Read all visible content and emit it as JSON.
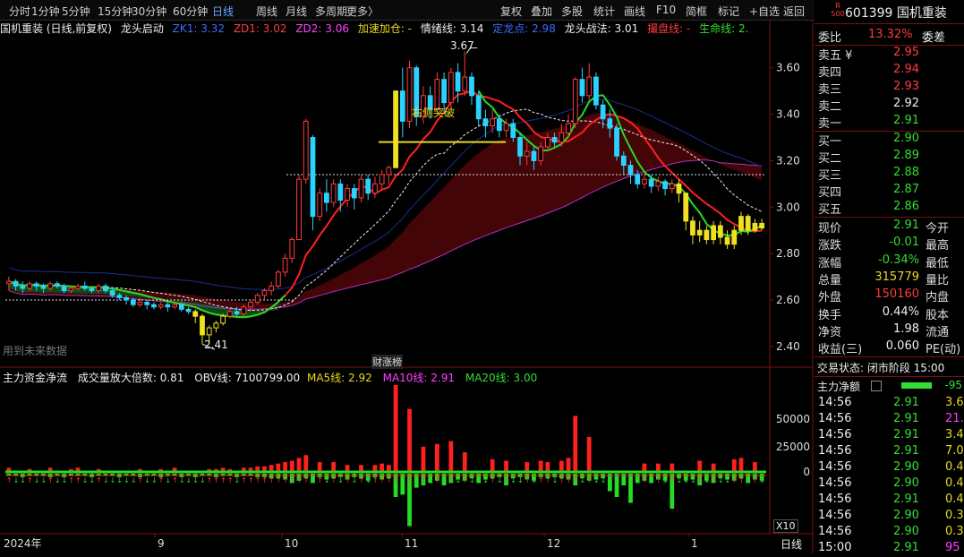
{
  "toolbar": {
    "left_tabs": [
      "分时",
      "1分钟",
      "5分钟",
      "15分钟",
      "30分钟",
      "60分钟",
      "日线",
      "周线",
      "月线",
      "多周期",
      "更多〉"
    ],
    "active_tab": "日线",
    "right_buttons": [
      "复权",
      "叠加",
      "多股",
      "统计",
      "画线",
      "F10",
      "简框",
      "标记",
      "+自选",
      "返回"
    ]
  },
  "stock": {
    "code": "601399",
    "name": "国机重装",
    "badge_top": "R",
    "badge_bottom": "500"
  },
  "info_bar": {
    "title": "国机重装 (日线,前复权)",
    "indicator": "龙头启动",
    "zk1": "ZK1: 3.32",
    "zd1": "ZD1: 3.02",
    "zd2": "ZD2: 3.06",
    "jsjc": "加速加仓: -",
    "qxx": "情绪线: 3.14",
    "dld": "定龙点: 2.98",
    "ltzf": "龙头战法: 3.01",
    "cpx": "撮盘线: -",
    "smx": "生命线: 2."
  },
  "price_axis": [
    "3.60",
    "3.40",
    "3.20",
    "3.00",
    "2.80",
    "2.60",
    "2.40"
  ],
  "vol_axis": [
    "50000",
    "25000",
    "0"
  ],
  "annotations": {
    "high": "3.67",
    "low": "2.41",
    "breakout": "右侧突破",
    "future_data": "用到未来数据",
    "earnings": "财",
    "limit_up": "涨榜"
  },
  "sub_bar": {
    "title": "主力资金净流",
    "vol_mult": "成交量放大倍数: 0.81",
    "obv": "OBV线: 7100799.00",
    "ma5": "MA5线: 2.92",
    "ma10": "MA10线: 2.91",
    "ma20": "MA20线: 3.00"
  },
  "time_axis": [
    "2024年",
    "9",
    "10",
    "11",
    "12",
    "1"
  ],
  "x_mult": "X10",
  "period": "日线",
  "order_book": {
    "webi_label": "委比",
    "webi": "13.32%",
    "wecha_label": "委差",
    "asks": [
      {
        "label": "卖五 ¥",
        "price": "2.95",
        "color": "#ff3b3b"
      },
      {
        "label": "卖四",
        "price": "2.94",
        "color": "#ff3b3b"
      },
      {
        "label": "卖三",
        "price": "2.93",
        "color": "#ff3b3b"
      },
      {
        "label": "卖二",
        "price": "2.92",
        "color": "#eeeeee"
      },
      {
        "label": "卖一",
        "price": "2.91",
        "color": "#33dd33"
      }
    ],
    "bids": [
      {
        "label": "买一",
        "price": "2.90",
        "color": "#33dd33"
      },
      {
        "label": "买二",
        "price": "2.89",
        "color": "#33dd33"
      },
      {
        "label": "买三",
        "price": "2.88",
        "color": "#33dd33"
      },
      {
        "label": "买四",
        "price": "2.87",
        "color": "#33dd33"
      },
      {
        "label": "买五",
        "price": "2.86",
        "color": "#33dd33"
      }
    ]
  },
  "quote": [
    {
      "l": "现价",
      "v": "2.91",
      "vc": "#33dd33",
      "r": "今开"
    },
    {
      "l": "涨跌",
      "v": "-0.01",
      "vc": "#33dd33",
      "r": "最高"
    },
    {
      "l": "涨幅",
      "v": "-0.34%",
      "vc": "#33dd33",
      "r": "最低"
    },
    {
      "l": "总量",
      "v": "315779",
      "vc": "#e8d820",
      "r": "量比"
    },
    {
      "l": "外盘",
      "v": "150160",
      "vc": "#ff3b3b",
      "r": "内盘"
    },
    {
      "l": "换手",
      "v": "0.44%",
      "vc": "#eeeeee",
      "r": "股本"
    },
    {
      "l": "净资",
      "v": "1.98",
      "vc": "#eeeeee",
      "r": "流通"
    },
    {
      "l": "收益(三)",
      "v": "0.060",
      "vc": "#eeeeee",
      "r": "PE(动)"
    }
  ],
  "trade_status": "交易状态: 闭市阶段 15:00",
  "main_flow": {
    "label": "主力净额",
    "value": "-95"
  },
  "ticks": [
    {
      "t": "14:56",
      "p": "2.91",
      "v": "3.6",
      "vc": "#e8d820"
    },
    {
      "t": "14:56",
      "p": "2.91",
      "v": "21.5",
      "vc": "#ff40ff"
    },
    {
      "t": "14:56",
      "p": "2.91",
      "v": "3.4",
      "vc": "#e8d820"
    },
    {
      "t": "14:56",
      "p": "2.91",
      "v": "7.0",
      "vc": "#e8d820"
    },
    {
      "t": "14:56",
      "p": "2.90",
      "v": "0.4",
      "vc": "#e8d820"
    },
    {
      "t": "14:56",
      "p": "2.90",
      "v": "0.4",
      "vc": "#e8d820"
    },
    {
      "t": "14:56",
      "p": "2.91",
      "v": "0.4",
      "vc": "#e8d820"
    },
    {
      "t": "14:56",
      "p": "2.90",
      "v": "0.3",
      "vc": "#e8d820"
    },
    {
      "t": "14:56",
      "p": "2.90",
      "v": "0.3",
      "vc": "#e8d820"
    },
    {
      "t": "15:00",
      "p": "2.91",
      "v": "95",
      "vc": "#ff40ff"
    }
  ],
  "colors": {
    "up": "#ff3b3b",
    "down": "#33dd33",
    "bg": "#000000",
    "grid": "#7a1010"
  },
  "chart_data": {
    "type": "candlestick",
    "y_range": [
      2.33,
      3.73
    ],
    "candles": [
      [
        2.67,
        2.68,
        2.64,
        2.7
      ],
      [
        2.68,
        2.66,
        2.64,
        2.69
      ],
      [
        2.66,
        2.65,
        2.63,
        2.68
      ],
      [
        2.65,
        2.67,
        2.64,
        2.68
      ],
      [
        2.67,
        2.66,
        2.64,
        2.68
      ],
      [
        2.66,
        2.65,
        2.63,
        2.67
      ],
      [
        2.65,
        2.67,
        2.64,
        2.68
      ],
      [
        2.67,
        2.66,
        2.65,
        2.68
      ],
      [
        2.66,
        2.64,
        2.63,
        2.67
      ],
      [
        2.64,
        2.65,
        2.63,
        2.66
      ],
      [
        2.65,
        2.66,
        2.64,
        2.67
      ],
      [
        2.66,
        2.65,
        2.64,
        2.68
      ],
      [
        2.65,
        2.64,
        2.63,
        2.66
      ],
      [
        2.64,
        2.66,
        2.63,
        2.67
      ],
      [
        2.66,
        2.64,
        2.63,
        2.67
      ],
      [
        2.64,
        2.62,
        2.61,
        2.65
      ],
      [
        2.62,
        2.61,
        2.6,
        2.63
      ],
      [
        2.61,
        2.6,
        2.58,
        2.62
      ],
      [
        2.6,
        2.58,
        2.57,
        2.61
      ],
      [
        2.58,
        2.59,
        2.57,
        2.61
      ],
      [
        2.59,
        2.58,
        2.56,
        2.6
      ],
      [
        2.58,
        2.57,
        2.56,
        2.59
      ],
      [
        2.57,
        2.58,
        2.56,
        2.59
      ],
      [
        2.58,
        2.57,
        2.55,
        2.59
      ],
      [
        2.57,
        2.58,
        2.56,
        2.59
      ],
      [
        2.58,
        2.56,
        2.55,
        2.59
      ],
      [
        2.56,
        2.55,
        2.54,
        2.57
      ],
      [
        2.55,
        2.53,
        2.5,
        2.56
      ],
      [
        2.53,
        2.45,
        2.41,
        2.54
      ],
      [
        2.45,
        2.48,
        2.42,
        2.49
      ],
      [
        2.48,
        2.5,
        2.46,
        2.51
      ],
      [
        2.5,
        2.53,
        2.49,
        2.54
      ],
      [
        2.53,
        2.55,
        2.52,
        2.56
      ],
      [
        2.55,
        2.54,
        2.53,
        2.57
      ],
      [
        2.54,
        2.57,
        2.53,
        2.58
      ],
      [
        2.57,
        2.59,
        2.55,
        2.6
      ],
      [
        2.59,
        2.62,
        2.58,
        2.63
      ],
      [
        2.62,
        2.64,
        2.6,
        2.65
      ],
      [
        2.64,
        2.66,
        2.62,
        2.68
      ],
      [
        2.66,
        2.72,
        2.65,
        2.73
      ],
      [
        2.72,
        2.78,
        2.7,
        2.8
      ],
      [
        2.78,
        2.86,
        2.76,
        2.87
      ],
      [
        2.86,
        3.12,
        2.86,
        3.14
      ],
      [
        3.12,
        3.37,
        3.1,
        3.38
      ],
      [
        3.3,
        2.96,
        2.9,
        3.31
      ],
      [
        2.96,
        3.06,
        2.94,
        3.08
      ],
      [
        3.06,
        3.02,
        2.98,
        3.12
      ],
      [
        3.02,
        3.1,
        3.0,
        3.12
      ],
      [
        3.1,
        3.03,
        2.98,
        3.12
      ],
      [
        3.03,
        3.08,
        3.0,
        3.1
      ],
      [
        3.08,
        3.04,
        2.99,
        3.1
      ],
      [
        3.04,
        3.12,
        3.02,
        3.14
      ],
      [
        3.12,
        3.06,
        3.03,
        3.14
      ],
      [
        3.06,
        3.1,
        3.04,
        3.13
      ],
      [
        3.1,
        3.14,
        3.08,
        3.16
      ],
      [
        3.14,
        3.17,
        3.1,
        3.18
      ],
      [
        3.17,
        3.5,
        3.17,
        3.5
      ],
      [
        3.5,
        3.37,
        3.3,
        3.6
      ],
      [
        3.37,
        3.6,
        3.34,
        3.63
      ],
      [
        3.6,
        3.39,
        3.35,
        3.61
      ],
      [
        3.39,
        3.48,
        3.36,
        3.52
      ],
      [
        3.48,
        3.42,
        3.38,
        3.52
      ],
      [
        3.42,
        3.55,
        3.4,
        3.58
      ],
      [
        3.55,
        3.45,
        3.4,
        3.58
      ],
      [
        3.45,
        3.58,
        3.42,
        3.6
      ],
      [
        3.58,
        3.5,
        3.45,
        3.62
      ],
      [
        3.5,
        3.56,
        3.48,
        3.67
      ],
      [
        3.56,
        3.48,
        3.44,
        3.58
      ],
      [
        3.48,
        3.38,
        3.35,
        3.5
      ],
      [
        3.38,
        3.35,
        3.3,
        3.42
      ],
      [
        3.35,
        3.38,
        3.32,
        3.42
      ],
      [
        3.38,
        3.33,
        3.3,
        3.4
      ],
      [
        3.33,
        3.36,
        3.3,
        3.38
      ],
      [
        3.36,
        3.3,
        3.28,
        3.38
      ],
      [
        3.3,
        3.22,
        3.18,
        3.32
      ],
      [
        3.22,
        3.24,
        3.18,
        3.28
      ],
      [
        3.24,
        3.2,
        3.16,
        3.26
      ],
      [
        3.2,
        3.26,
        3.18,
        3.28
      ],
      [
        3.26,
        3.3,
        3.24,
        3.32
      ],
      [
        3.3,
        3.28,
        3.26,
        3.32
      ],
      [
        3.28,
        3.32,
        3.26,
        3.36
      ],
      [
        3.32,
        3.36,
        3.3,
        3.4
      ],
      [
        3.36,
        3.55,
        3.34,
        3.56
      ],
      [
        3.55,
        3.48,
        3.45,
        3.6
      ],
      [
        3.48,
        3.56,
        3.46,
        3.62
      ],
      [
        3.56,
        3.44,
        3.42,
        3.58
      ],
      [
        3.44,
        3.38,
        3.34,
        3.46
      ],
      [
        3.38,
        3.34,
        3.3,
        3.42
      ],
      [
        3.34,
        3.22,
        3.2,
        3.36
      ],
      [
        3.22,
        3.18,
        3.14,
        3.24
      ],
      [
        3.18,
        3.14,
        3.1,
        3.2
      ],
      [
        3.14,
        3.1,
        3.08,
        3.16
      ],
      [
        3.1,
        3.12,
        3.08,
        3.15
      ],
      [
        3.12,
        3.09,
        3.06,
        3.14
      ],
      [
        3.09,
        3.11,
        3.07,
        3.13
      ],
      [
        3.11,
        3.08,
        3.05,
        3.12
      ],
      [
        3.08,
        3.1,
        3.06,
        3.12
      ],
      [
        3.1,
        3.06,
        3.02,
        3.12
      ],
      [
        3.06,
        2.94,
        2.9,
        3.06
      ],
      [
        2.94,
        2.88,
        2.84,
        2.96
      ],
      [
        2.88,
        2.9,
        2.85,
        2.94
      ],
      [
        2.9,
        2.86,
        2.84,
        2.92
      ],
      [
        2.86,
        2.92,
        2.84,
        2.94
      ],
      [
        2.92,
        2.87,
        2.84,
        2.94
      ],
      [
        2.87,
        2.84,
        2.82,
        2.9
      ],
      [
        2.84,
        2.9,
        2.82,
        2.92
      ],
      [
        2.9,
        2.96,
        2.88,
        2.98
      ],
      [
        2.96,
        2.9,
        2.88,
        2.97
      ],
      [
        2.9,
        2.93,
        2.89,
        2.95
      ],
      [
        2.93,
        2.91,
        2.9,
        2.95
      ]
    ],
    "volumes": [
      3,
      2,
      4,
      2,
      3,
      2,
      3,
      2,
      4,
      2,
      3,
      2,
      3,
      2,
      3,
      3,
      2,
      2,
      3,
      2,
      2,
      3,
      2,
      2,
      3,
      2,
      2,
      3,
      4,
      2,
      2,
      3,
      2,
      2,
      3,
      3,
      4,
      4,
      5,
      6,
      7,
      8,
      10,
      12,
      9,
      7,
      6,
      7,
      6,
      5,
      6,
      5,
      6,
      5,
      6,
      5,
      62,
      30,
      45,
      28,
      18,
      15,
      20,
      14,
      22,
      16,
      14,
      12,
      10,
      8,
      9,
      7,
      8,
      7,
      6,
      7,
      6,
      8,
      7,
      6,
      8,
      10,
      40,
      22,
      25,
      18,
      12,
      10,
      9,
      8,
      8,
      7,
      6,
      7,
      6,
      7,
      6,
      8,
      9,
      10,
      8,
      7,
      6,
      8,
      7,
      9,
      10,
      8,
      7,
      6
    ],
    "outflows": [
      2,
      2,
      3,
      2,
      2,
      2,
      3,
      2,
      3,
      2,
      2,
      2,
      3,
      2,
      2,
      2,
      3,
      2,
      2,
      3,
      2,
      2,
      3,
      2,
      2,
      3,
      2,
      3,
      2,
      2,
      3,
      2,
      2,
      3,
      2,
      2,
      3,
      3,
      4,
      4,
      5,
      8,
      6,
      4,
      8,
      3,
      5,
      4,
      3,
      5,
      3,
      4,
      6,
      3,
      5,
      4,
      20,
      18,
      45,
      12,
      10,
      8,
      6,
      10,
      8,
      5,
      6,
      4,
      8,
      5,
      4,
      3,
      10,
      4,
      3,
      5,
      6,
      3,
      4,
      3,
      4,
      5,
      10,
      4,
      6,
      5,
      4,
      15,
      20,
      10,
      25,
      8,
      6,
      8,
      5,
      6,
      30,
      4,
      6,
      5,
      10,
      6,
      8,
      4,
      5,
      6,
      4,
      8,
      5,
      6
    ]
  }
}
